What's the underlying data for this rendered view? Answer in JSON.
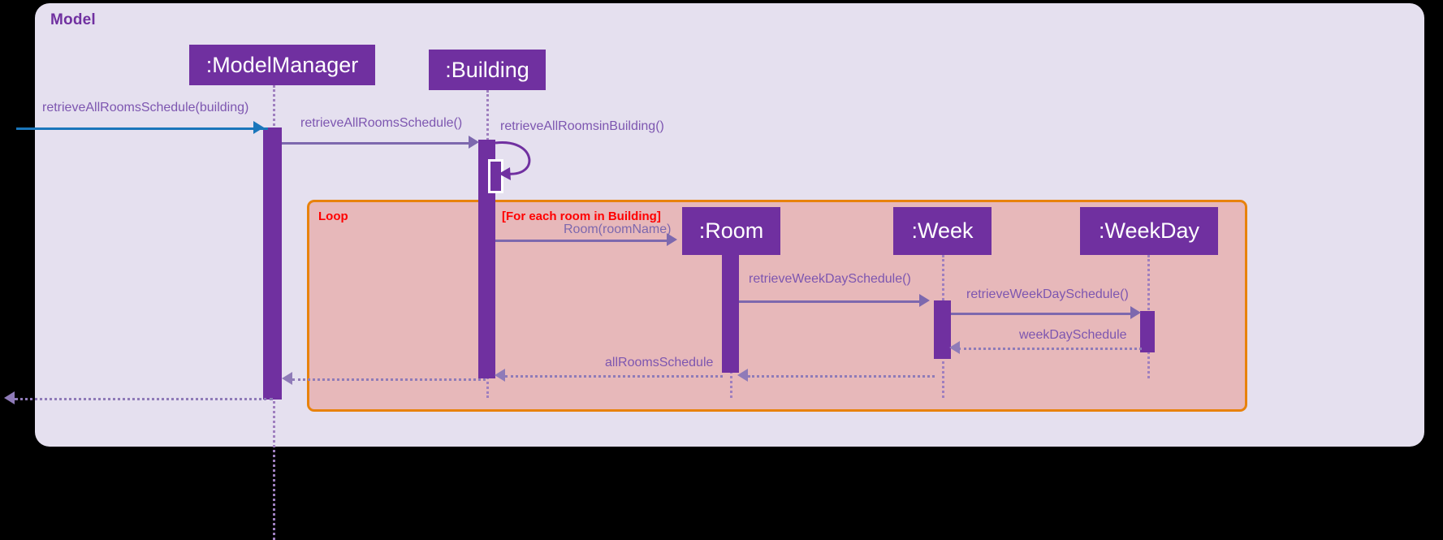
{
  "diagram": {
    "type": "uml-sequence-diagram",
    "frame_title": "Model",
    "colors": {
      "frame_background": "#e5e0ef",
      "participant_fill": "#7030a0",
      "participant_text": "#ffffff",
      "loop_border": "#e8820c",
      "loop_fill": "#e7b8ba",
      "loop_label_text": "#ff0000",
      "message_line": "#7d68ae",
      "message_text": "#7d56b0",
      "entry_arrow": "#1a76bb",
      "lifeline": "#9f7fbf",
      "canvas": "#000000"
    }
  },
  "participants": [
    {
      "id": "modelmanager",
      "label": ":ModelManager"
    },
    {
      "id": "building",
      "label": ":Building"
    },
    {
      "id": "room",
      "label": ":Room"
    },
    {
      "id": "week",
      "label": ":Week"
    },
    {
      "id": "weekday",
      "label": ":WeekDay"
    }
  ],
  "fragment": {
    "kind": "Loop",
    "label": "Loop",
    "guard": "[For each room in Building]"
  },
  "messages": [
    {
      "id": "m1",
      "label": "retrieveAllRoomsSchedule(building)",
      "from": "actor",
      "to": "modelmanager",
      "kind": "call",
      "style": "entry"
    },
    {
      "id": "m2",
      "label": "retrieveAllRoomsSchedule()",
      "from": "modelmanager",
      "to": "building",
      "kind": "call",
      "style": "solid"
    },
    {
      "id": "m3",
      "label": "retrieveAllRoomsinBuilding()",
      "from": "building",
      "to": "building",
      "kind": "self",
      "style": "solid"
    },
    {
      "id": "m4",
      "label": "Room(roomName)",
      "from": "building",
      "to": "room",
      "kind": "create",
      "style": "solid"
    },
    {
      "id": "m5",
      "label": "retrieveWeekDaySchedule()",
      "from": "room",
      "to": "week",
      "kind": "call",
      "style": "solid"
    },
    {
      "id": "m6",
      "label": "retrieveWeekDaySchedule()",
      "from": "week",
      "to": "weekday",
      "kind": "call",
      "style": "solid"
    },
    {
      "id": "m7",
      "label": "weekDaySchedule",
      "from": "weekday",
      "to": "week",
      "kind": "return",
      "style": "dotted"
    },
    {
      "id": "m8",
      "label": "allRoomsSchedule",
      "from": "week",
      "to": "room",
      "kind": "return",
      "style": "dotted"
    },
    {
      "id": "m9",
      "label": "",
      "from": "room",
      "to": "building",
      "kind": "return",
      "style": "dotted"
    },
    {
      "id": "m10",
      "label": "",
      "from": "building",
      "to": "modelmanager",
      "kind": "return",
      "style": "dotted"
    },
    {
      "id": "m11",
      "label": "",
      "from": "modelmanager",
      "to": "actor",
      "kind": "return",
      "style": "dotted"
    }
  ]
}
